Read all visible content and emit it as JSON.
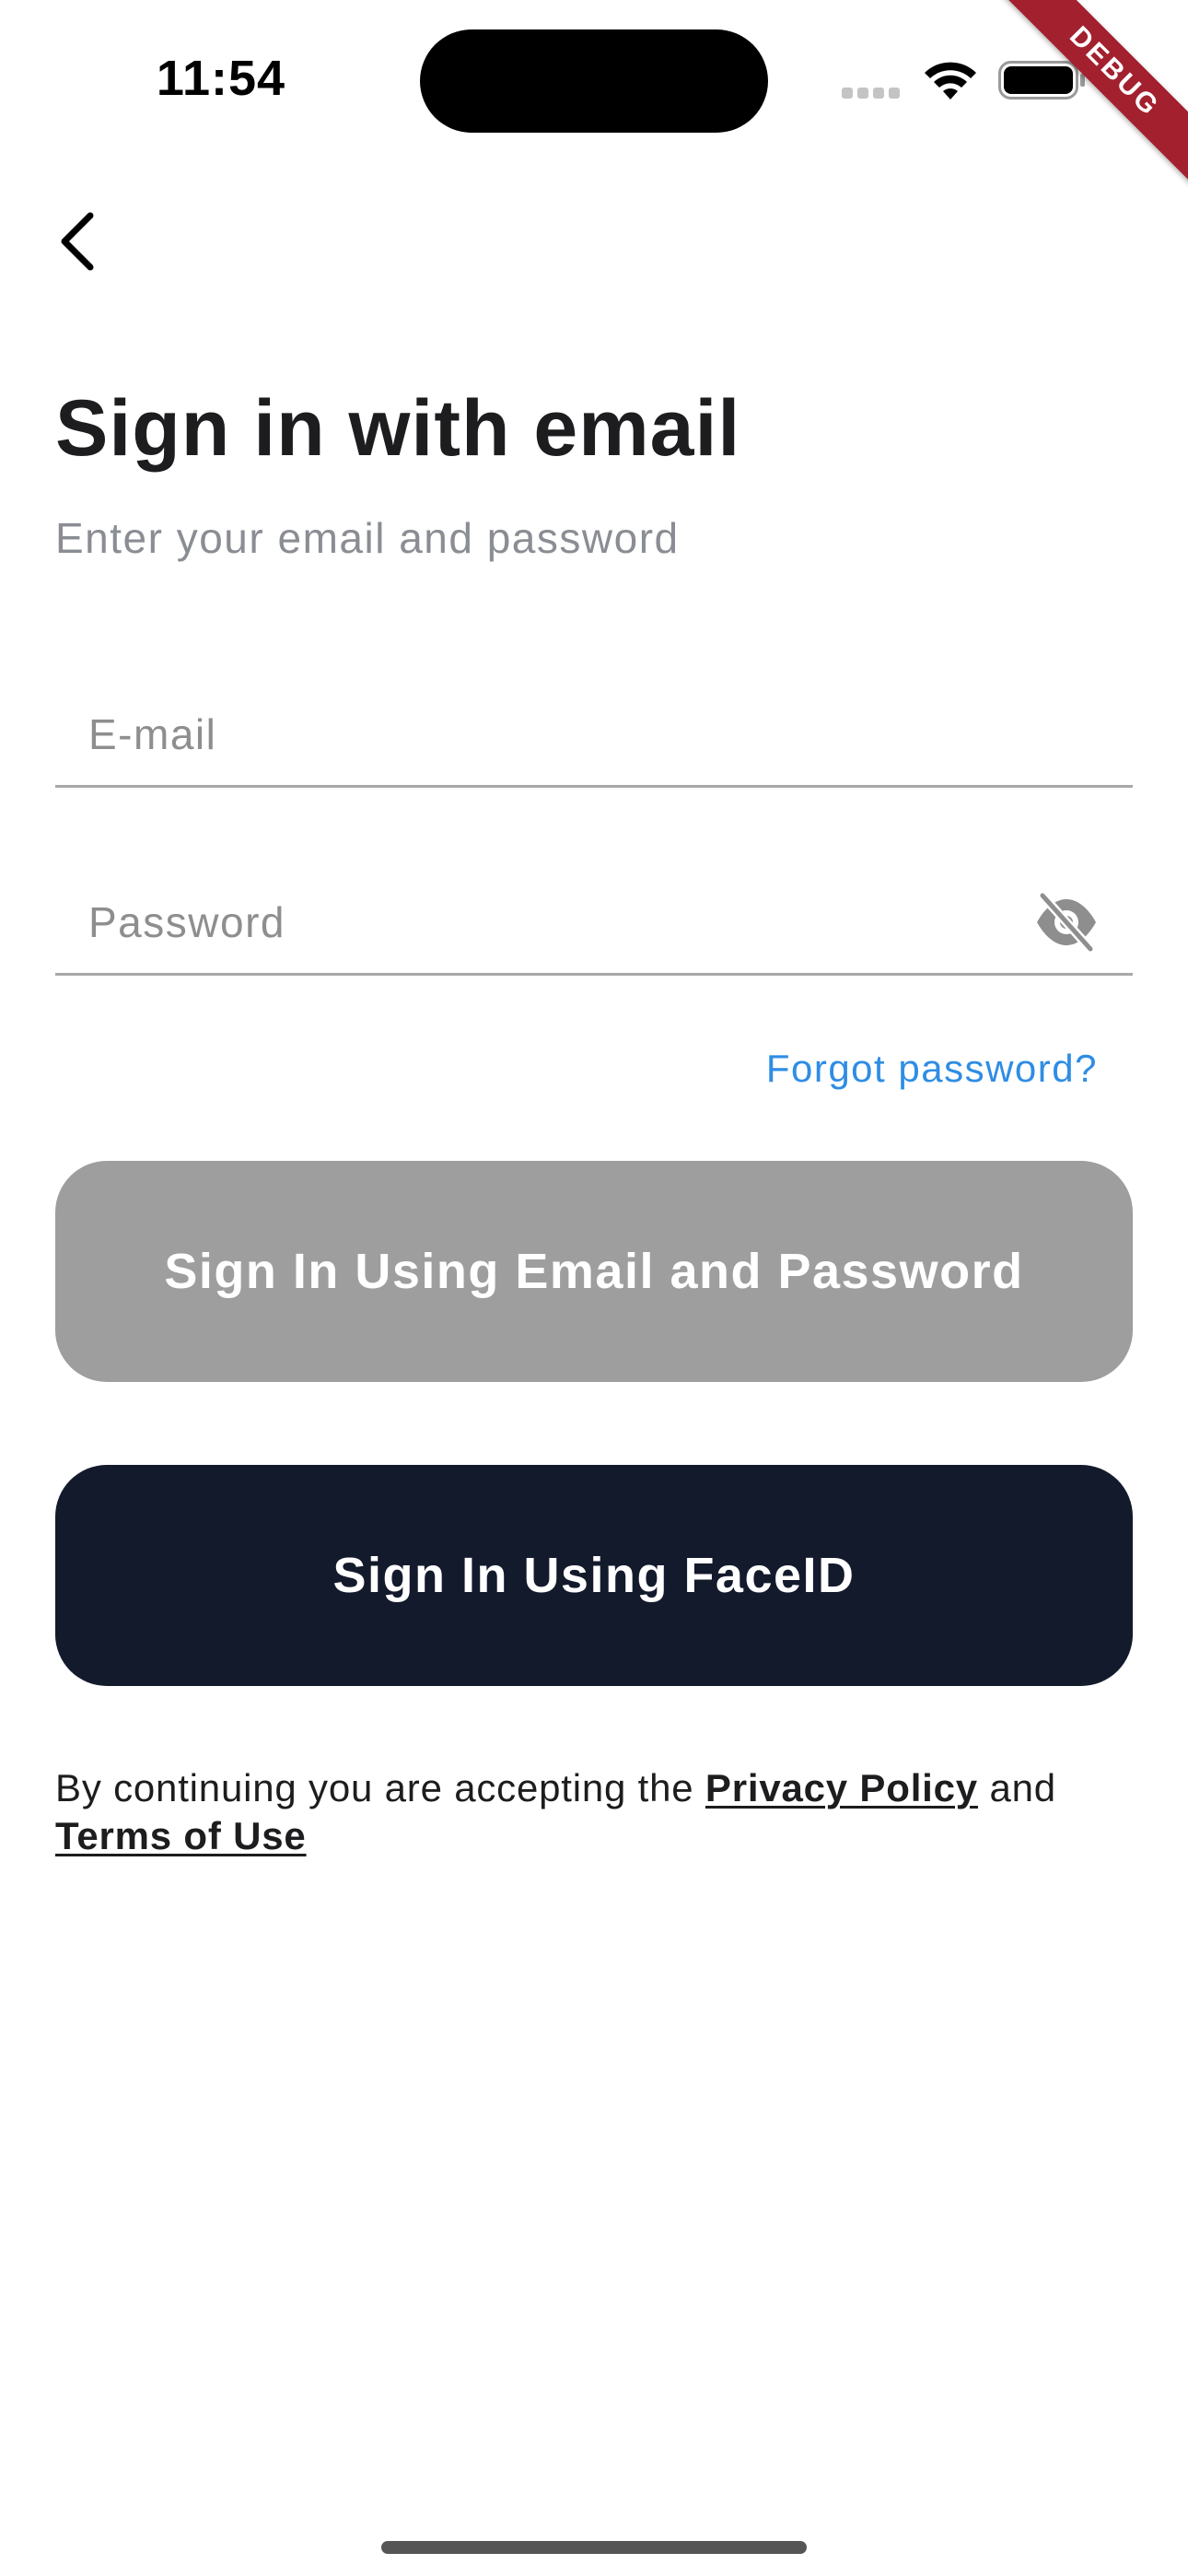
{
  "status_bar": {
    "time": "11:54"
  },
  "debug_banner": {
    "label": "DEBUG",
    "color": "#a3202f"
  },
  "header": {
    "back_icon": "chevron-left-icon"
  },
  "page": {
    "title": "Sign in with email",
    "subtitle": "Enter your email and password"
  },
  "form": {
    "email": {
      "placeholder": "E-mail",
      "value": ""
    },
    "password": {
      "placeholder": "Password",
      "value": "",
      "toggle_icon": "eye-off-icon"
    },
    "forgot_password_label": "Forgot password?"
  },
  "actions": {
    "email_signin_label": "Sign In Using Email and Password",
    "faceid_signin_label": "Sign In Using FaceID"
  },
  "legal": {
    "prefix": "By continuing you are accepting the ",
    "privacy_label": "Privacy Policy",
    "middle": " and",
    "terms_label": "Terms of Use"
  },
  "colors": {
    "link": "#2f8de4",
    "button_disabled": "#9e9e9e",
    "button_primary": "#131a2c",
    "title": "#1d1d1f",
    "subtitle": "#8a8d93"
  }
}
